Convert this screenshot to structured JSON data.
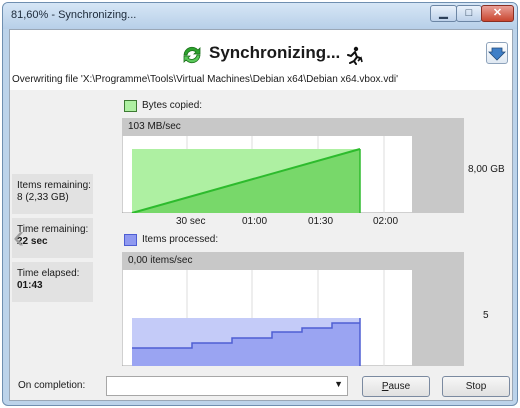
{
  "window": {
    "title": "81,60% - Synchronizing...",
    "controls": {
      "minimize_icon": "minimize-icon",
      "maximize_icon": "maximize-icon",
      "close_icon": "close-icon"
    }
  },
  "header": {
    "heading": "Synchronizing...",
    "status_icon": "sync-icon",
    "activity_icon": "runner-icon",
    "collapse_icon": "chevron-down-icon",
    "current_operation": "Overwriting file 'X:\\Programme\\Tools\\Virtual Machines\\Debian x64\\Debian x64.vbox.vdi'"
  },
  "stats": {
    "items_remaining": {
      "label": "Items remaining:",
      "value": "8 (2,33 GB)"
    },
    "time_remaining": {
      "label": "Time remaining:",
      "value": "22 sec"
    },
    "time_elapsed": {
      "label": "Time elapsed:",
      "value": "01:43"
    }
  },
  "charts": [
    {
      "name": "bytes-copied",
      "legend": "Bytes copied:",
      "rate": "103 MB/sec",
      "y_max_label": "8,00 GB",
      "x_ticks": [
        "30 sec",
        "01:00",
        "01:30",
        "02:00"
      ],
      "color": "#aef0a2"
    },
    {
      "name": "items-processed",
      "legend": "Items processed:",
      "rate": "0,00 items/sec",
      "y_max_label": "5",
      "color": "#b9c1f7"
    }
  ],
  "footer": {
    "on_completion_label": "On completion:",
    "on_completion_value": "",
    "pause_label": "Pause",
    "pause_mnemonic": "P",
    "stop_label": "Stop"
  },
  "colors": {
    "accent": "#3f7fc7",
    "progress_green": "#2dbb2d",
    "items_blue": "#4e5ed3",
    "grey": "#c8c8c8"
  }
}
